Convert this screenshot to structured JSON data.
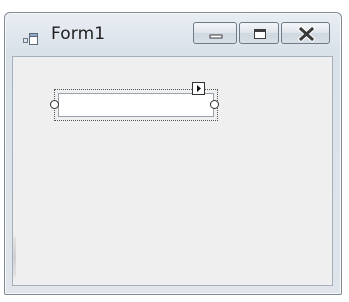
{
  "window": {
    "title": "Form1",
    "icon": "form-icon",
    "buttons": {
      "minimize": "minimize-icon",
      "maximize": "maximize-icon",
      "close": "close-icon"
    }
  },
  "designer": {
    "selected_control": "textbox",
    "textbox_value": "",
    "smart_tag_icon": "arrow-right-icon"
  },
  "colors": {
    "client_background": "#efefef",
    "selection_border": "#555555",
    "close_glyph": "#3a3a3a"
  }
}
